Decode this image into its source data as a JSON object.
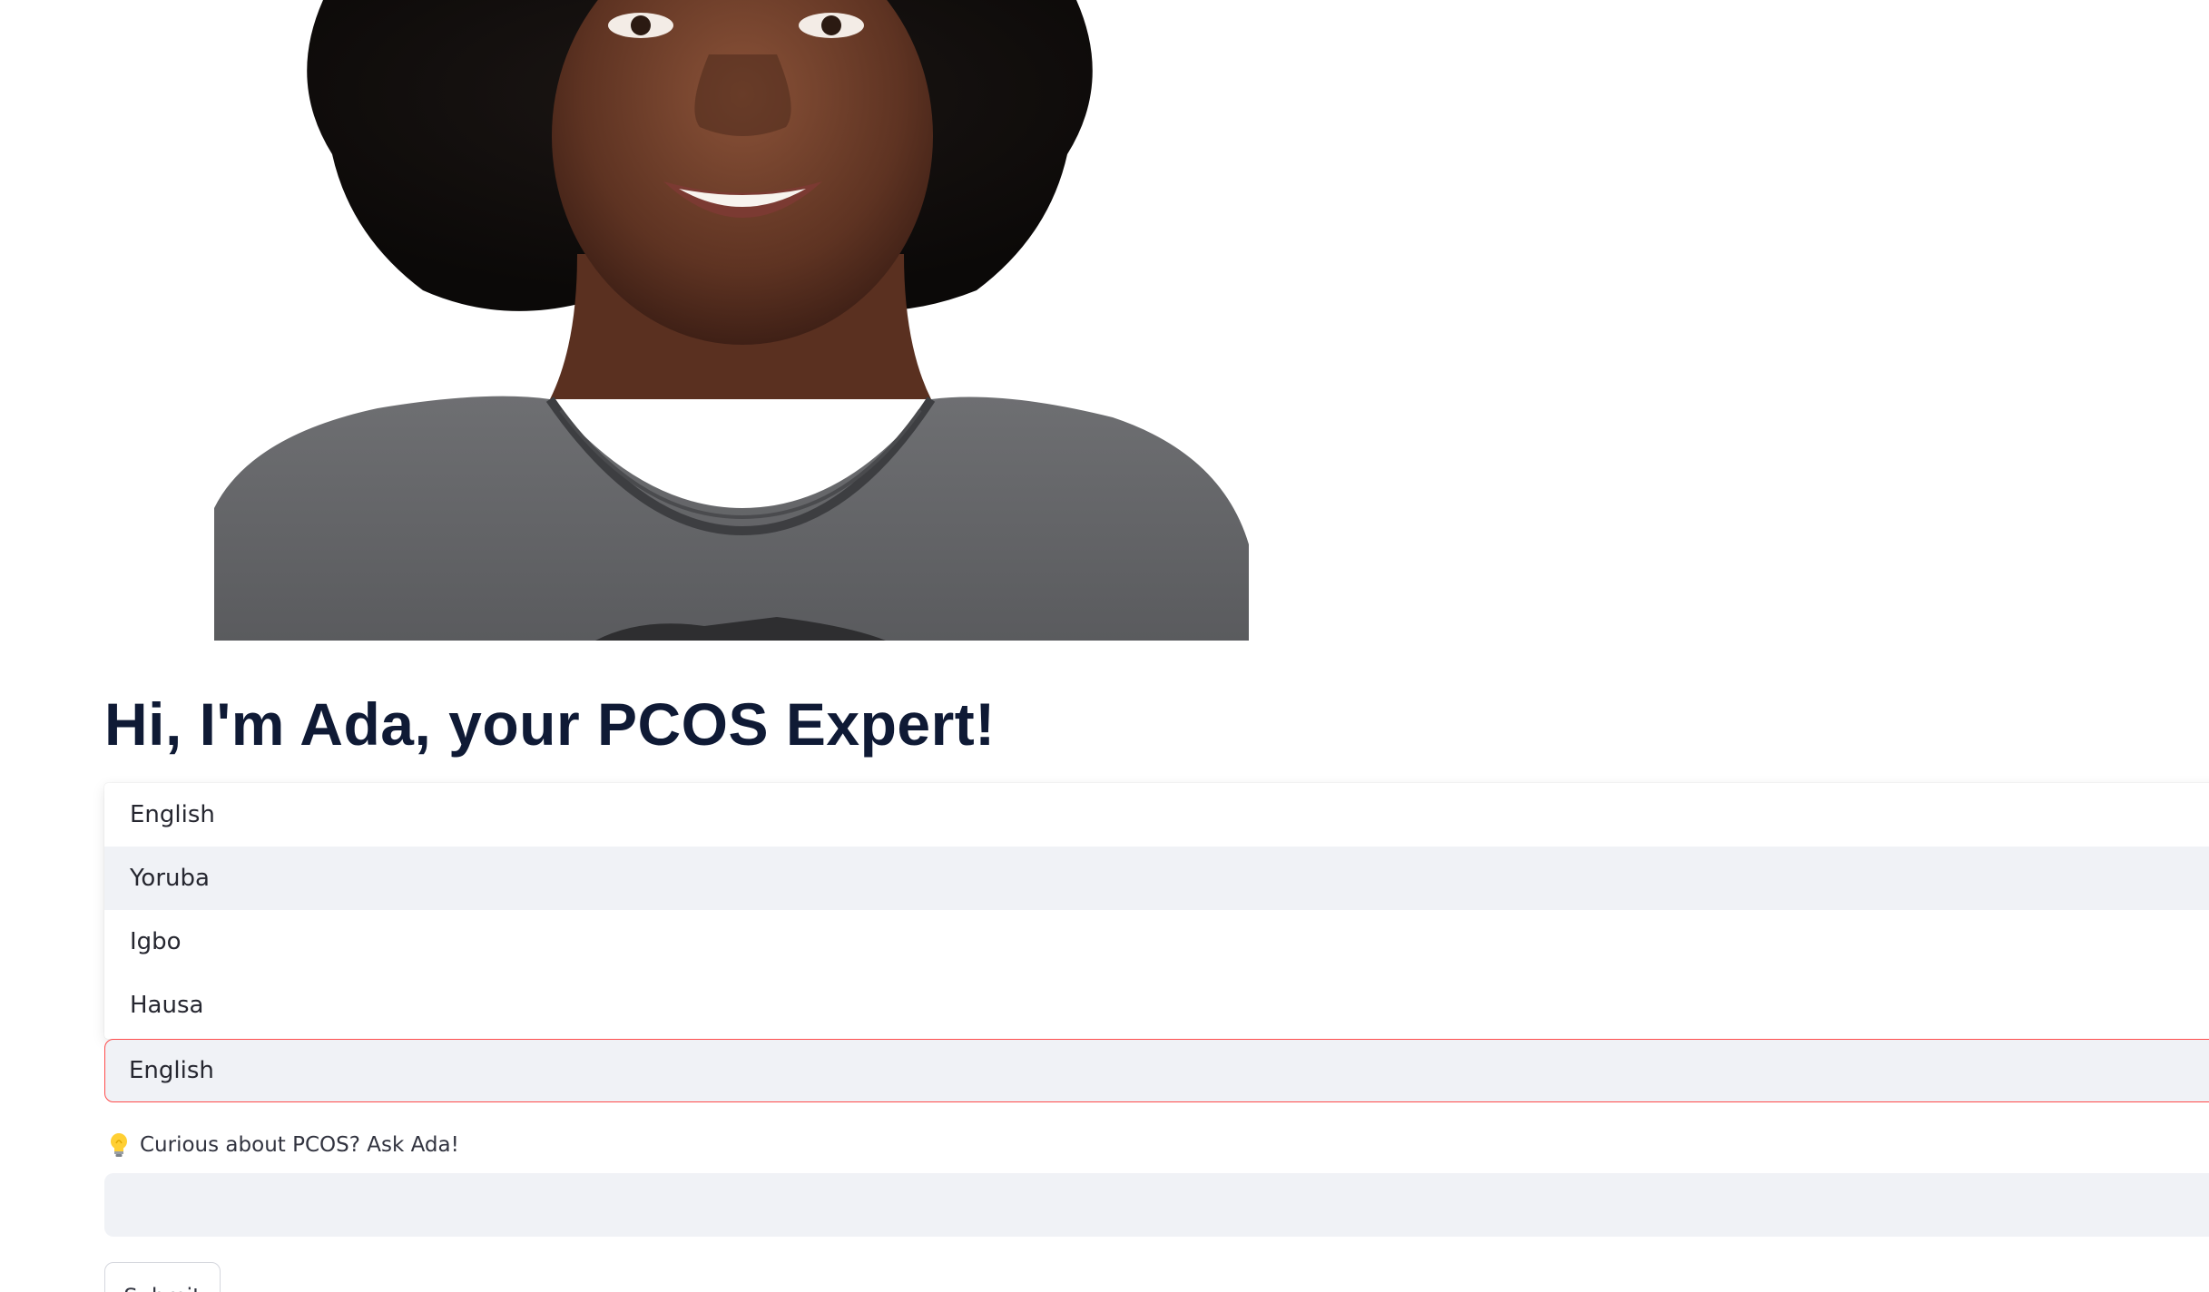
{
  "hero": {
    "image_subject": "portrait of smiling woman with afro hair in grey t-shirt"
  },
  "title": "Hi, I'm Ada, your PCOS Expert!",
  "language_select": {
    "options": [
      "English",
      "Yoruba",
      "Igbo",
      "Hausa"
    ],
    "hovered_option": "Yoruba",
    "selected_value": "English",
    "focus_border_color": "#ff4b4b"
  },
  "question": {
    "icon": "lightbulb-icon",
    "label": "Curious about PCOS? Ask Ada!",
    "value": ""
  },
  "submit_label": "Submit",
  "colors": {
    "title": "#0f1a35",
    "input_bg": "#f0f2f6",
    "accent": "#ff4b4b"
  }
}
